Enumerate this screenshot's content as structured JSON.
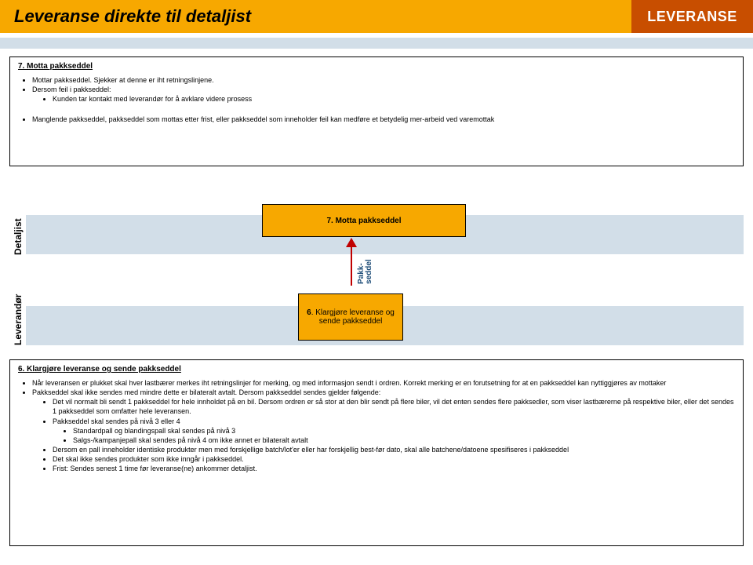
{
  "header": {
    "title": "Leveranse direkte til detaljist",
    "tag": "LEVERANSE"
  },
  "top_panel": {
    "heading": "7. Motta pakkseddel",
    "b1": "Mottar pakkseddel. Sjekker at denne er iht retningslinjene.",
    "b2": "Dersom feil i pakkseddel:",
    "b2a": "Kunden tar kontakt med leverandør for å avklare videre prosess",
    "b3": "Manglende pakkseddel, pakkseddel som mottas etter frist,  eller pakkseddel som inneholder feil kan medføre et betydelig mer-arbeid ved varemottak"
  },
  "lanes": {
    "detaljist": "Detaljist",
    "leverandor": "Leverandør"
  },
  "boxes": {
    "b7_num": "7",
    "b7_txt": ". Motta pakkseddel",
    "b6_num": "6",
    "b6_txt": ". Klargjøre leveranse og sende pakkseddel"
  },
  "arrow": {
    "label_l1": "Pakk-",
    "label_l2": "seddel"
  },
  "bottom_panel": {
    "heading": "6. Klargjøre  leveranse  og sende  pakkseddel",
    "b1": "Når leveransen er plukket skal hver lastbærer merkes iht retningslinjer for merking, og med informasjon sendt i ordren. Korrekt merking er en forutsetning for at en pakkseddel kan nyttiggjøres av mottaker",
    "b2": "Pakkseddel skal ikke sendes med mindre dette er bilateralt avtalt. Dersom pakkseddel sendes gjelder følgende:",
    "b2a": "Det vil normalt bli sendt 1 pakkseddel for hele innholdet på en bil. Dersom ordren er så stor at den blir sendt på flere biler, vil det enten sendes flere pakksedler, som viser lastbærerne på respektive biler, eller det sendes 1 pakkseddel som omfatter hele leveransen.",
    "b2b": "Pakkseddel skal sendes på nivå 3 eller 4",
    "b2b1": "Standardpall og blandingspall skal sendes på nivå 3",
    "b2b2": "Salgs-/kampanjepall skal sendes på nivå 4 om ikke annet er bilateralt avtalt",
    "b2c": "Dersom en pall inneholder identiske produkter men med forskjellige batch/lot'er eller har forskjellig best-før dato, skal alle batchene/datoene spesifiseres i pakkseddel",
    "b2d": "Det skal ikke sendes produkter som ikke inngår i pakkseddel.",
    "b2e": "Frist: Sendes senest 1 time før leveranse(ne) ankommer detaljist."
  }
}
